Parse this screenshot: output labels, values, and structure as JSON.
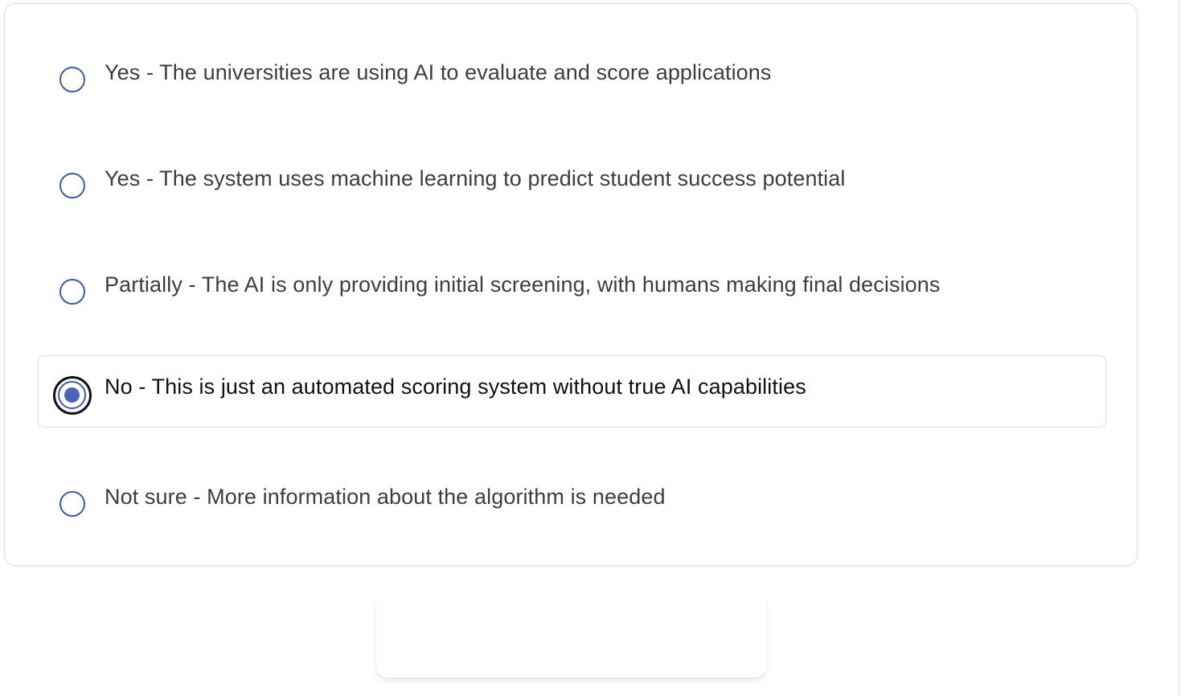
{
  "question": {
    "options": [
      {
        "label": "Yes - The universities are using AI to evaluate and score applications",
        "selected": false
      },
      {
        "label": "Yes - The system uses machine learning to predict student success potential",
        "selected": false
      },
      {
        "label": "Partially - The AI is only providing initial screening, with humans making final decisions",
        "selected": false
      },
      {
        "label": "No - This is just an automated scoring system without true AI capabilities",
        "selected": true
      },
      {
        "label": "Not sure - More information about the algorithm is needed",
        "selected": false
      }
    ]
  },
  "colors": {
    "radio_border": "#3f5aa6",
    "radio_fill": "#4e63b8",
    "focus_ring": "#111111",
    "card_border": "#dcdfe4",
    "text": "#3d3d3f"
  }
}
